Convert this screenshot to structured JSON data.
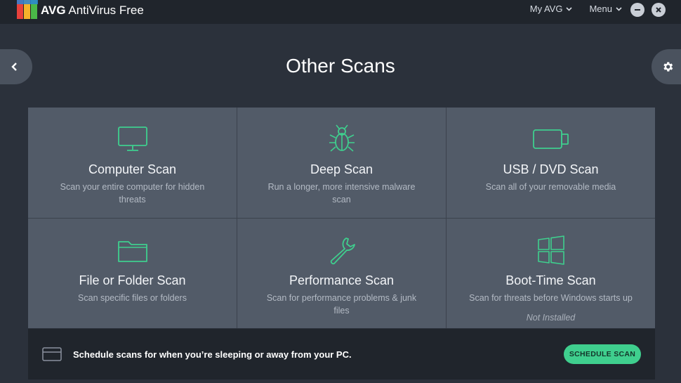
{
  "app": {
    "brand": "AVG",
    "name": "AntiVirus Free",
    "links": [
      {
        "label": "My AVG"
      },
      {
        "label": "Menu"
      }
    ]
  },
  "page": {
    "title": "Other Scans"
  },
  "scans": [
    {
      "title": "Computer Scan",
      "description": "Scan your entire computer for hidden threats",
      "icon": "monitor-icon"
    },
    {
      "title": "Deep Scan",
      "description": "Run a longer, more intensive malware scan",
      "icon": "bug-icon"
    },
    {
      "title": "USB / DVD Scan",
      "description": "Scan all of your removable media",
      "icon": "usb-drive-icon"
    },
    {
      "title": "File or Folder Scan",
      "description": "Scan specific files or folders",
      "icon": "folder-icon"
    },
    {
      "title": "Performance Scan",
      "description": "Scan for performance problems & junk files",
      "icon": "wrench-icon"
    },
    {
      "title": "Boot-Time Scan",
      "description": "Scan for threats before Windows starts up",
      "note": "Not Installed",
      "icon": "windows-icon"
    }
  ],
  "schedule": {
    "text": "Schedule scans for when you’re sleeping or away from your PC.",
    "button": "SCHEDULE SCAN"
  },
  "colors": {
    "accent": "#3fcf8e",
    "icon_stroke": "#3fcf8e",
    "tile": "#525b68",
    "background": "#2b313b"
  }
}
